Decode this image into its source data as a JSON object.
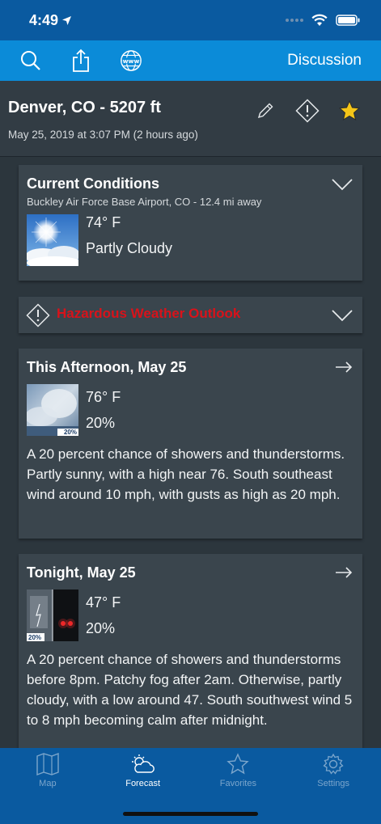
{
  "status_bar": {
    "time": "4:49"
  },
  "toolbar": {
    "discussion_label": "Discussion"
  },
  "location": {
    "title": "Denver, CO - 5207 ft",
    "updated": "May 25, 2019 at 3:07 PM (2 hours ago)"
  },
  "current": {
    "title": "Current Conditions",
    "station": "Buckley Air Force Base Airport, CO - 12.4 mi away",
    "temperature": "74° F",
    "condition": "Partly Cloudy"
  },
  "hazard": {
    "label": "Hazardous Weather Outlook"
  },
  "forecast": [
    {
      "title": "This Afternoon, May 25",
      "temperature": "76° F",
      "precip": "20%",
      "icon_badge": "20%",
      "description": "A 20 percent chance of showers and thunderstorms.  Partly sunny, with a high near 76. South southeast wind around 10 mph, with gusts as high as 20 mph."
    },
    {
      "title": "Tonight, May 25",
      "temperature": "47° F",
      "precip": "20%",
      "icon_badge": "20%",
      "description": "A 20 percent chance of showers and thunderstorms before 8pm.  Patchy fog after 2am.  Otherwise, partly cloudy, with a low around 47. South southwest wind 5 to 8 mph becoming calm  after midnight."
    }
  ],
  "tabs": [
    {
      "label": "Map",
      "icon": "map-icon",
      "active": false
    },
    {
      "label": "Forecast",
      "icon": "forecast-icon",
      "active": true
    },
    {
      "label": "Favorites",
      "icon": "star-icon",
      "active": false
    },
    {
      "label": "Settings",
      "icon": "gear-icon",
      "active": false
    }
  ],
  "colors": {
    "status_bar": "#0a5aa0",
    "toolbar": "#0b8bd8",
    "card": "#3a454d",
    "background": "#2c363d",
    "hazard": "#d9121a",
    "favorite_star": "#f5c518"
  }
}
